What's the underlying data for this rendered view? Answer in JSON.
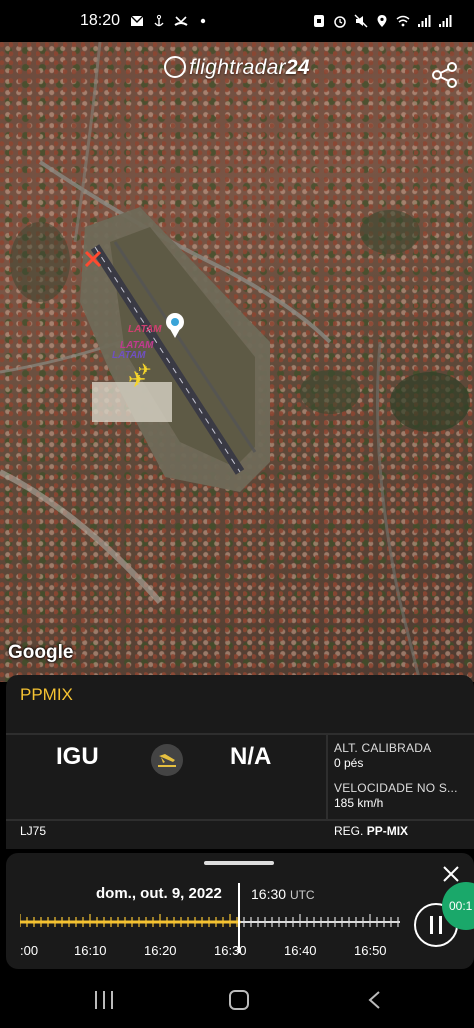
{
  "status_bar": {
    "time": "18:20",
    "left_icons": [
      "mail-icon",
      "anchor-icon",
      "missed-call-icon",
      "dot-icon"
    ],
    "right_icons": [
      "nfc-icon",
      "alarm-icon",
      "mute-icon",
      "location-icon",
      "wifi-icon",
      "signal-icon",
      "signal-icon"
    ]
  },
  "app": {
    "logo_text": "flightradar",
    "logo_num": "24"
  },
  "map": {
    "google_label": "Google",
    "markers": [
      "LATAM",
      "LATAM",
      "LATAM"
    ]
  },
  "flight": {
    "callsign": "PPMIX",
    "origin": "IGU",
    "destination": "N/A",
    "altitude_label": "ALT. CALIBRADA",
    "altitude_value": "0 pés",
    "speed_label": "VELOCIDADE NO S...",
    "speed_value": "185 km/h",
    "flight_number": "LJ75",
    "reg_label": "REG.",
    "reg_value": "PP-MIX"
  },
  "playback": {
    "date": "dom., out. 9, 2022",
    "time": "16:30",
    "tz": "UTC",
    "ticks": [
      ":00",
      "16:10",
      "16:20",
      "16:30",
      "16:40",
      "16:50"
    ],
    "progress_fraction": 0.58,
    "recording_badge": "00:1"
  },
  "colors": {
    "accent": "#f5c332",
    "panel": "#1a1a1a",
    "record": "#1aa86a"
  }
}
